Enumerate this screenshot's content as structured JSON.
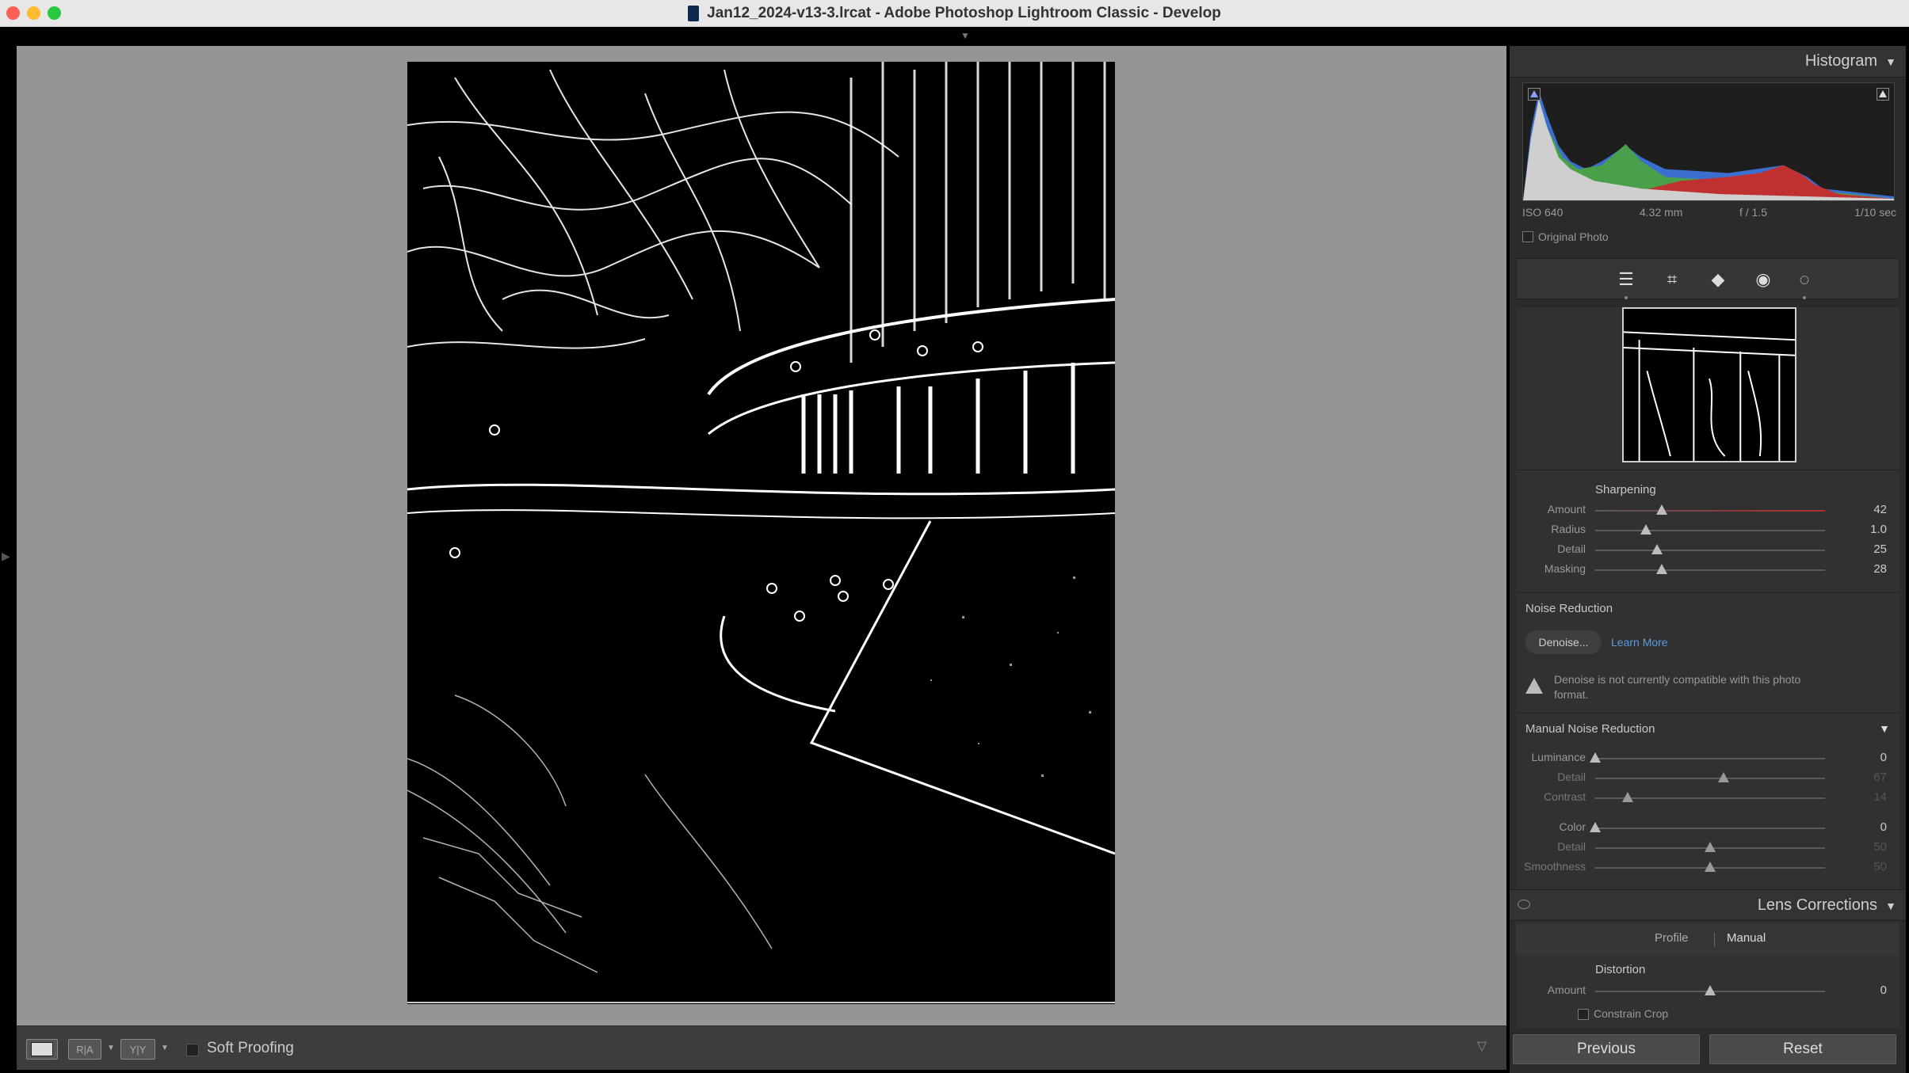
{
  "window": {
    "title": "Jan12_2024-v13-3.lrcat - Adobe Photoshop Lightroom Classic - Develop"
  },
  "toolbar": {
    "soft_proofing_label": "Soft Proofing"
  },
  "histogram": {
    "title": "Histogram",
    "iso": "ISO 640",
    "focal_length": "4.32 mm",
    "aperture": "f / 1.5",
    "shutter": "1/10 sec",
    "original_photo_label": "Original Photo"
  },
  "tools": {
    "items": [
      "sliders-icon",
      "crop-icon",
      "eraser-icon",
      "redeye-icon",
      "mask-icon"
    ]
  },
  "detail": {
    "sharpening": {
      "title": "Sharpening",
      "amount_label": "Amount",
      "amount_value": "42",
      "amount_fraction": 0.29,
      "radius_label": "Radius",
      "radius_value": "1.0",
      "radius_fraction": 0.22,
      "detail_label": "Detail",
      "detail_value": "25",
      "detail_fraction": 0.27,
      "masking_label": "Masking",
      "masking_value": "28",
      "masking_fraction": 0.29
    },
    "noise_reduction": {
      "title": "Noise Reduction",
      "denoise_label": "Denoise...",
      "learn_more": "Learn More",
      "warning": "Denoise is not currently compatible with this photo format.",
      "manual_title": "Manual Noise Reduction",
      "luminance_label": "Luminance",
      "luminance_value": "0",
      "luminance_fraction": 0.0,
      "lum_detail_label": "Detail",
      "lum_detail_value": "67",
      "lum_detail_fraction": 0.56,
      "lum_contrast_label": "Contrast",
      "lum_contrast_value": "14",
      "lum_contrast_fraction": 0.14,
      "color_label": "Color",
      "color_value": "0",
      "color_fraction": 0.0,
      "color_detail_label": "Detail",
      "color_detail_value": "50",
      "color_detail_fraction": 0.5,
      "smoothness_label": "Smoothness",
      "smoothness_value": "50",
      "smoothness_fraction": 0.5
    }
  },
  "lens": {
    "title": "Lens Corrections",
    "tab_profile": "Profile",
    "tab_manual": "Manual",
    "distortion_title": "Distortion",
    "amount_label": "Amount",
    "amount_value": "0",
    "amount_fraction": 0.5,
    "constrain_crop": "Constrain Crop"
  },
  "buttons": {
    "previous": "Previous",
    "reset": "Reset"
  },
  "colors": {
    "panel_bg": "#2b2b2b",
    "canvas_bg": "#959595",
    "accent_link": "#5a9bdc"
  }
}
